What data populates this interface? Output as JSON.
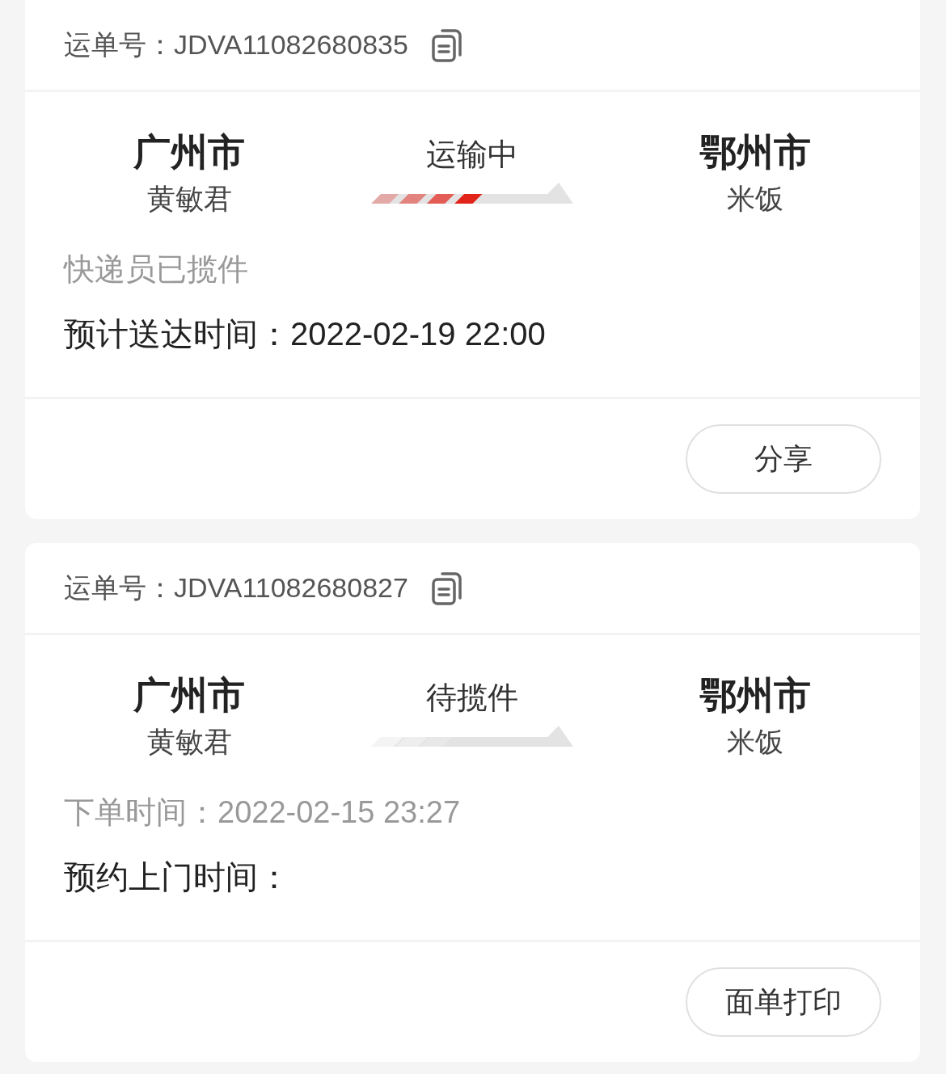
{
  "orders": [
    {
      "waybill_label": "运单号：",
      "waybill_no": "JDVA11082680835",
      "from_city": "广州市",
      "from_name": "黄敏君",
      "status": "运输中",
      "level": 0.55,
      "to_city": "鄂州市",
      "to_name": "米饭",
      "lines": [
        {
          "kind": "muted",
          "text": "快递员已揽件"
        },
        {
          "kind": "normal",
          "text": "预计送达时间：2022-02-19 22:00"
        }
      ],
      "button": "分享"
    },
    {
      "waybill_label": "运单号：",
      "waybill_no": "JDVA11082680827",
      "from_city": "广州市",
      "from_name": "黄敏君",
      "status": "待揽件",
      "to_city": "鄂州市",
      "to_name": "米饭",
      "lines": [
        {
          "kind": "muted",
          "text": "下单时间：2022-02-15 23:27"
        },
        {
          "kind": "normal",
          "text": "预约上门时间："
        }
      ],
      "button": "面单打印"
    }
  ]
}
